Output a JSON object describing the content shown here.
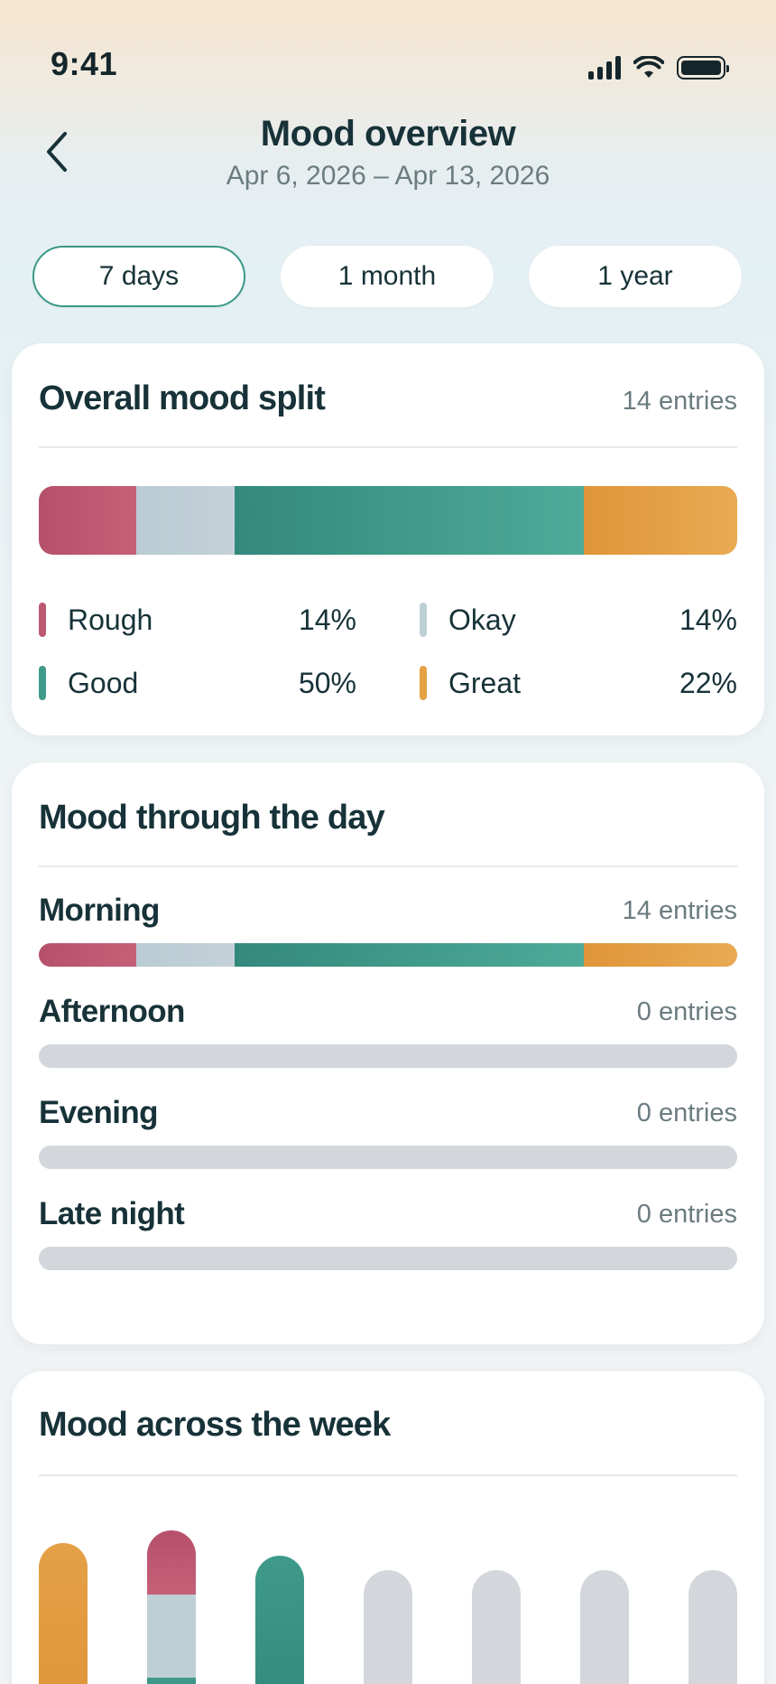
{
  "status_bar": {
    "time": "9:41"
  },
  "header": {
    "title": "Mood overview",
    "date_range": "Apr 6, 2026 – Apr 13, 2026"
  },
  "period_tabs": [
    {
      "label": "7 days",
      "active": true
    },
    {
      "label": "1 month",
      "active": false
    },
    {
      "label": "1 year",
      "active": false
    }
  ],
  "colors": {
    "rough": "#bd5872",
    "okay": "#bfcfd6",
    "good": "#3f9a8a",
    "great": "#e5a046",
    "empty": "#d3d7db",
    "accent": "#3a9887"
  },
  "overall_split": {
    "title": "Overall mood split",
    "entries": "14 entries",
    "segments": [
      {
        "mood": "rough",
        "label": "Rough",
        "value": "14%",
        "fraction": 0.14
      },
      {
        "mood": "okay",
        "label": "Okay",
        "value": "14%",
        "fraction": 0.14
      },
      {
        "mood": "good",
        "label": "Good",
        "value": "50%",
        "fraction": 0.5
      },
      {
        "mood": "great",
        "label": "Great",
        "value": "22%",
        "fraction": 0.22
      }
    ]
  },
  "through_day": {
    "title": "Mood through the day",
    "rows": [
      {
        "label": "Morning",
        "entries": "14 entries",
        "fractions": {
          "rough": 0.14,
          "okay": 0.14,
          "good": 0.5,
          "great": 0.22
        }
      },
      {
        "label": "Afternoon",
        "entries": "0 entries",
        "fractions": null
      },
      {
        "label": "Evening",
        "entries": "0 entries",
        "fractions": null
      },
      {
        "label": "Late night",
        "entries": "0 entries",
        "fractions": null
      }
    ]
  },
  "across_week": {
    "title": "Mood across the week",
    "days": [
      {
        "fractions": {
          "great": 1.0
        }
      },
      {
        "fractions": {
          "good": 0.2,
          "okay": 0.45,
          "rough": 0.35
        }
      },
      {
        "fractions": {
          "good": 1.0
        }
      },
      {
        "fractions": null
      },
      {
        "fractions": null
      },
      {
        "fractions": null
      },
      {
        "fractions": null
      }
    ]
  }
}
